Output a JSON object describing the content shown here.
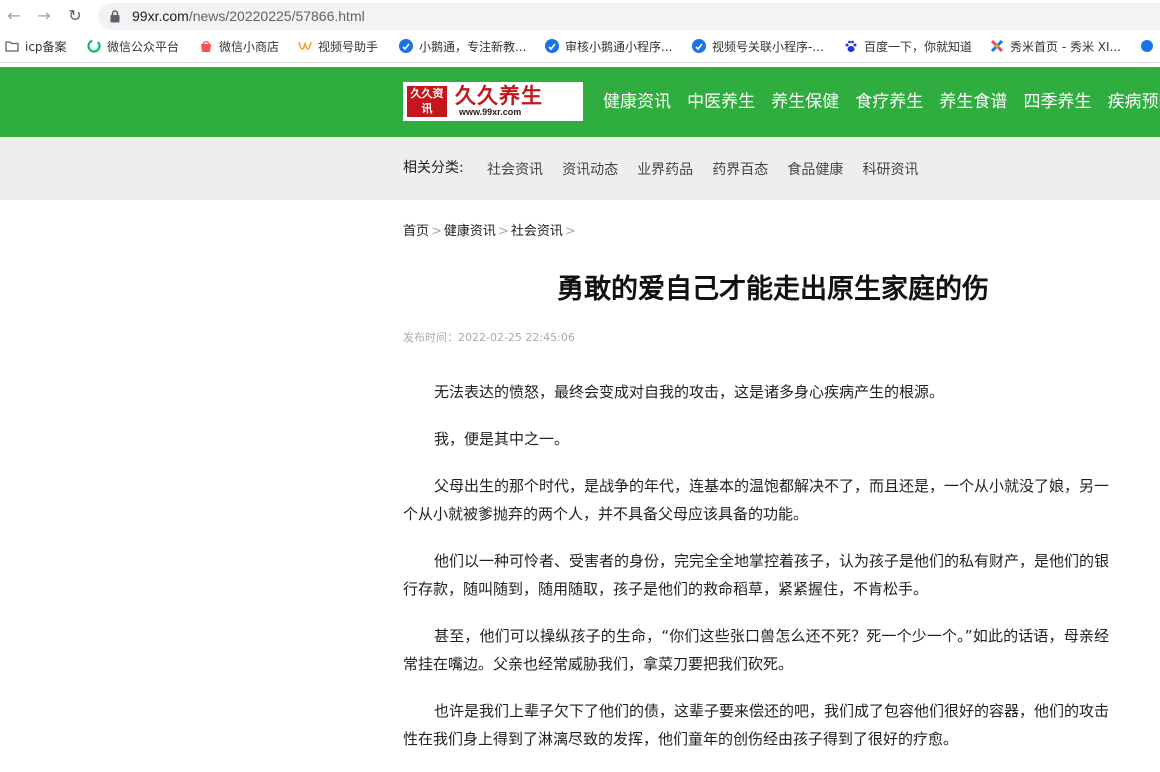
{
  "browser": {
    "url_host": "99xr.com",
    "url_path": "/news/20220225/57866.html"
  },
  "bookmarks": [
    {
      "label": "icp备案",
      "icon": "folder-icon",
      "color": "#5f6368"
    },
    {
      "label": "微信公众平台",
      "icon": "wechat-mp-icon",
      "color": "#07c160"
    },
    {
      "label": "微信小商店",
      "icon": "wechat-store-icon",
      "color": "#fa5151"
    },
    {
      "label": "视频号助手",
      "icon": "channels-icon",
      "color": "#f5a623"
    },
    {
      "label": "小鹅通，专注新教...",
      "icon": "xiaoe-icon",
      "color": "#1a73e8"
    },
    {
      "label": "审核小鹅通小程序...",
      "icon": "xiaoe-icon",
      "color": "#1a73e8"
    },
    {
      "label": "视频号关联小程序-...",
      "icon": "xiaoe-icon",
      "color": "#1a73e8"
    },
    {
      "label": "百度一下，你就知道",
      "icon": "baidu-paw-icon",
      "color": "#2932e1"
    },
    {
      "label": "秀米首页 - 秀米 XI...",
      "icon": "xiumi-icon",
      "color": "#e84a5f"
    }
  ],
  "site": {
    "logo_brand": "久久养生",
    "logo_seal": "久久资讯",
    "logo_domain": "www.99xr.com",
    "nav": [
      "健康资讯",
      "中医养生",
      "养生保健",
      "食疗养生",
      "养生食谱",
      "四季养生",
      "疾病预防"
    ],
    "subnav_label": "相关分类:",
    "subnav": [
      "社会资讯",
      "资讯动态",
      "业界药品",
      "药界百态",
      "食品健康",
      "科研资讯"
    ]
  },
  "article": {
    "breadcrumb": [
      "首页",
      "健康资讯",
      "社会资讯"
    ],
    "title": "勇敢的爱自己才能走出原生家庭的伤",
    "meta": "发布时间：2022-02-25 22:45:06",
    "paragraphs": [
      "无法表达的愤怒，最终会变成对自我的攻击，这是诸多身心疾病产生的根源。",
      "我，便是其中之一。",
      "父母出生的那个时代，是战争的年代，连基本的温饱都解决不了，而且还是，一个从小就没了娘，另一个从小就被爹抛弃的两个人，并不具备父母应该具备的功能。",
      "他们以一种可怜者、受害者的身份，完完全全地掌控着孩子，认为孩子是他们的私有财产，是他们的银行存款，随叫随到，随用随取，孩子是他们的救命稻草，紧紧握住，不肯松手。",
      "甚至，他们可以操纵孩子的生命，“你们这些张口兽怎么还不死？死一个少一个。”如此的话语，母亲经常挂在嘴边。父亲也经常威胁我们，拿菜刀要把我们砍死。",
      "也许是我们上辈子欠下了他们的债，这辈子要来偿还的吧，我们成了包容他们很好的容器，他们的攻击性在我们身上得到了淋漓尽致的发挥，他们童年的创伤经由孩子得到了很好的疗愈。"
    ]
  },
  "colors": {
    "header_green": "#2fad3e",
    "subbar_grey": "#eeeeee",
    "logo_red": "#c4161c"
  }
}
